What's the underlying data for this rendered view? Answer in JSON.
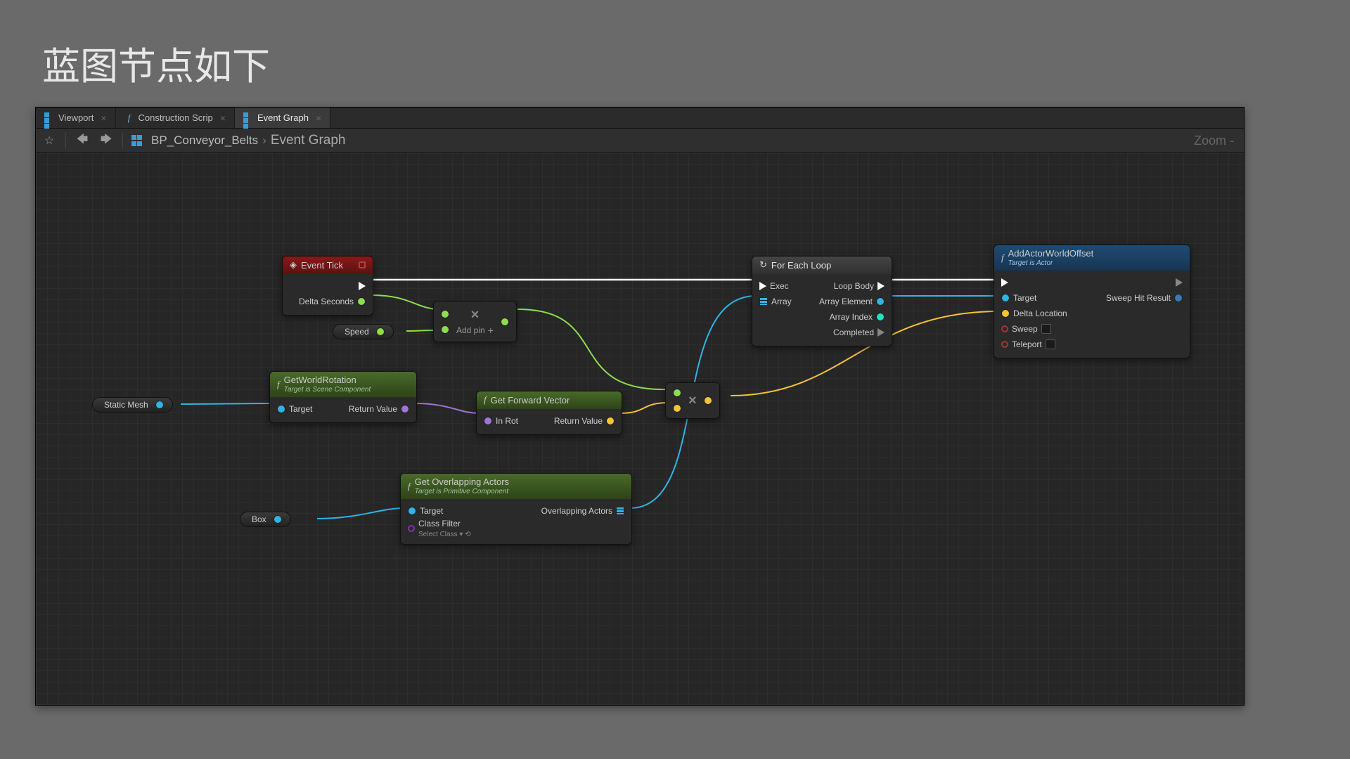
{
  "page_title": "蓝图节点如下",
  "tabs": [
    {
      "label": "Viewport",
      "type": "viewport",
      "active": false
    },
    {
      "label": "Construction Scrip",
      "type": "fn",
      "active": false
    },
    {
      "label": "Event Graph",
      "type": "graph",
      "active": true
    }
  ],
  "toolbar": {
    "blueprint_name": "BP_Conveyor_Belts",
    "graph_name": "Event Graph",
    "zoom_label": "Zoom -"
  },
  "chips": {
    "speed": "Speed",
    "static_mesh": "Static Mesh",
    "box": "Box"
  },
  "nodes": {
    "event_tick": {
      "title": "Event Tick",
      "out_exec": "",
      "out_delta": "Delta Seconds"
    },
    "mul1": {
      "add_pin": "Add pin"
    },
    "mul2": {},
    "get_world_rotation": {
      "title": "GetWorldRotation",
      "subtitle": "Target is Scene Component",
      "in_target": "Target",
      "out_return": "Return Value"
    },
    "get_forward_vector": {
      "title": "Get Forward Vector",
      "in_rot": "In Rot",
      "out_return": "Return Value"
    },
    "get_overlapping": {
      "title": "Get Overlapping Actors",
      "subtitle": "Target is Primitive Component",
      "in_target": "Target",
      "in_class_filter": "Class Filter",
      "select_class": "Select Class",
      "out_overlapping": "Overlapping Actors"
    },
    "for_each": {
      "title": "For Each Loop",
      "in_exec": "Exec",
      "in_array": "Array",
      "out_body": "Loop Body",
      "out_element": "Array Element",
      "out_index": "Array Index",
      "out_completed": "Completed"
    },
    "add_offset": {
      "title": "AddActorWorldOffset",
      "subtitle": "Target is Actor",
      "in_target": "Target",
      "in_delta": "Delta Location",
      "in_sweep": "Sweep",
      "in_teleport": "Teleport",
      "out_hit": "Sweep Hit Result"
    }
  }
}
